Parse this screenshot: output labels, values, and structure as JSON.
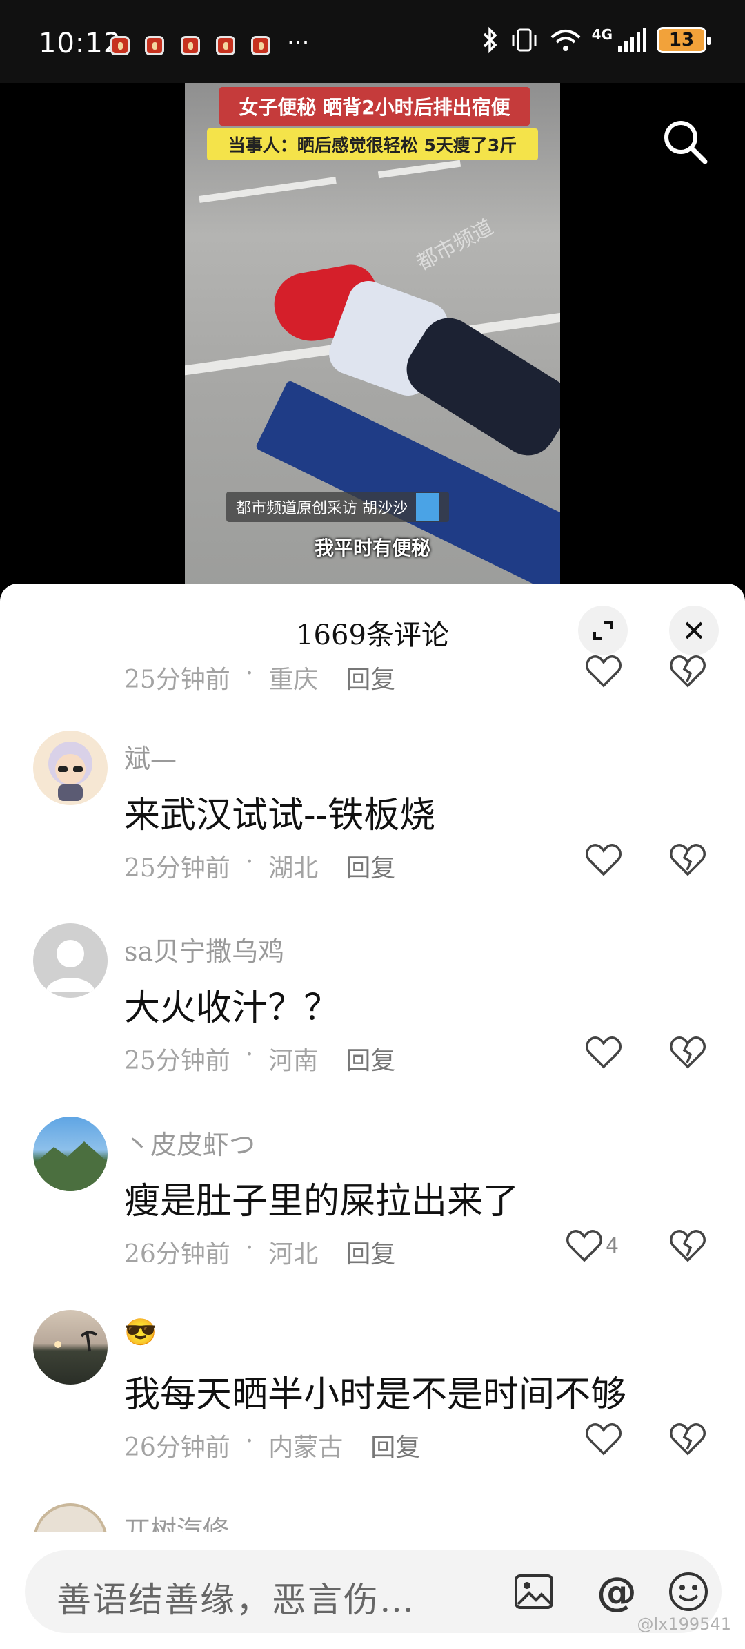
{
  "status_bar": {
    "time": "10:12",
    "more": "···",
    "network": "4G",
    "battery": "13"
  },
  "video": {
    "headline": "女子便秘 晒背2小时后排出宿便",
    "subheadline": "当事人：晒后感觉很轻松 5天瘦了3斤",
    "watermark": "都市频道",
    "credit": "都市频道原创采访 胡沙沙",
    "subtitle": "我平时有便秘"
  },
  "comments_panel": {
    "title": "1669条评论",
    "comments": [
      {
        "name": "",
        "text": "",
        "time": "25分钟前",
        "location": "重庆",
        "reply": "回复",
        "likes": ""
      },
      {
        "name": "斌—",
        "text": "来武汉试试--铁板烧",
        "time": "25分钟前",
        "location": "湖北",
        "reply": "回复",
        "likes": ""
      },
      {
        "name": "sa贝宁撒乌鸡",
        "text": "大火收汁？？",
        "time": "25分钟前",
        "location": "河南",
        "reply": "回复",
        "likes": ""
      },
      {
        "name": "丶皮皮虾つ",
        "text": "瘦是肚子里的屎拉出来了",
        "time": "26分钟前",
        "location": "河北",
        "reply": "回复",
        "likes": "4"
      },
      {
        "name": "😎",
        "text": "我每天晒半小时是不是时间不够",
        "time": "26分钟前",
        "location": "内蒙古",
        "reply": "回复",
        "likes": ""
      },
      {
        "name": "兀树汽修",
        "text": "",
        "time": "",
        "location": "",
        "reply": "",
        "likes": ""
      }
    ]
  },
  "input": {
    "placeholder": "善语结善缘，恶言伤…"
  },
  "watermark_credit": "@lx199541",
  "colors": {
    "headline_red": "#c53b3b",
    "subheadline_yellow": "#f4e34a",
    "battery_orange": "#f2a23a"
  }
}
